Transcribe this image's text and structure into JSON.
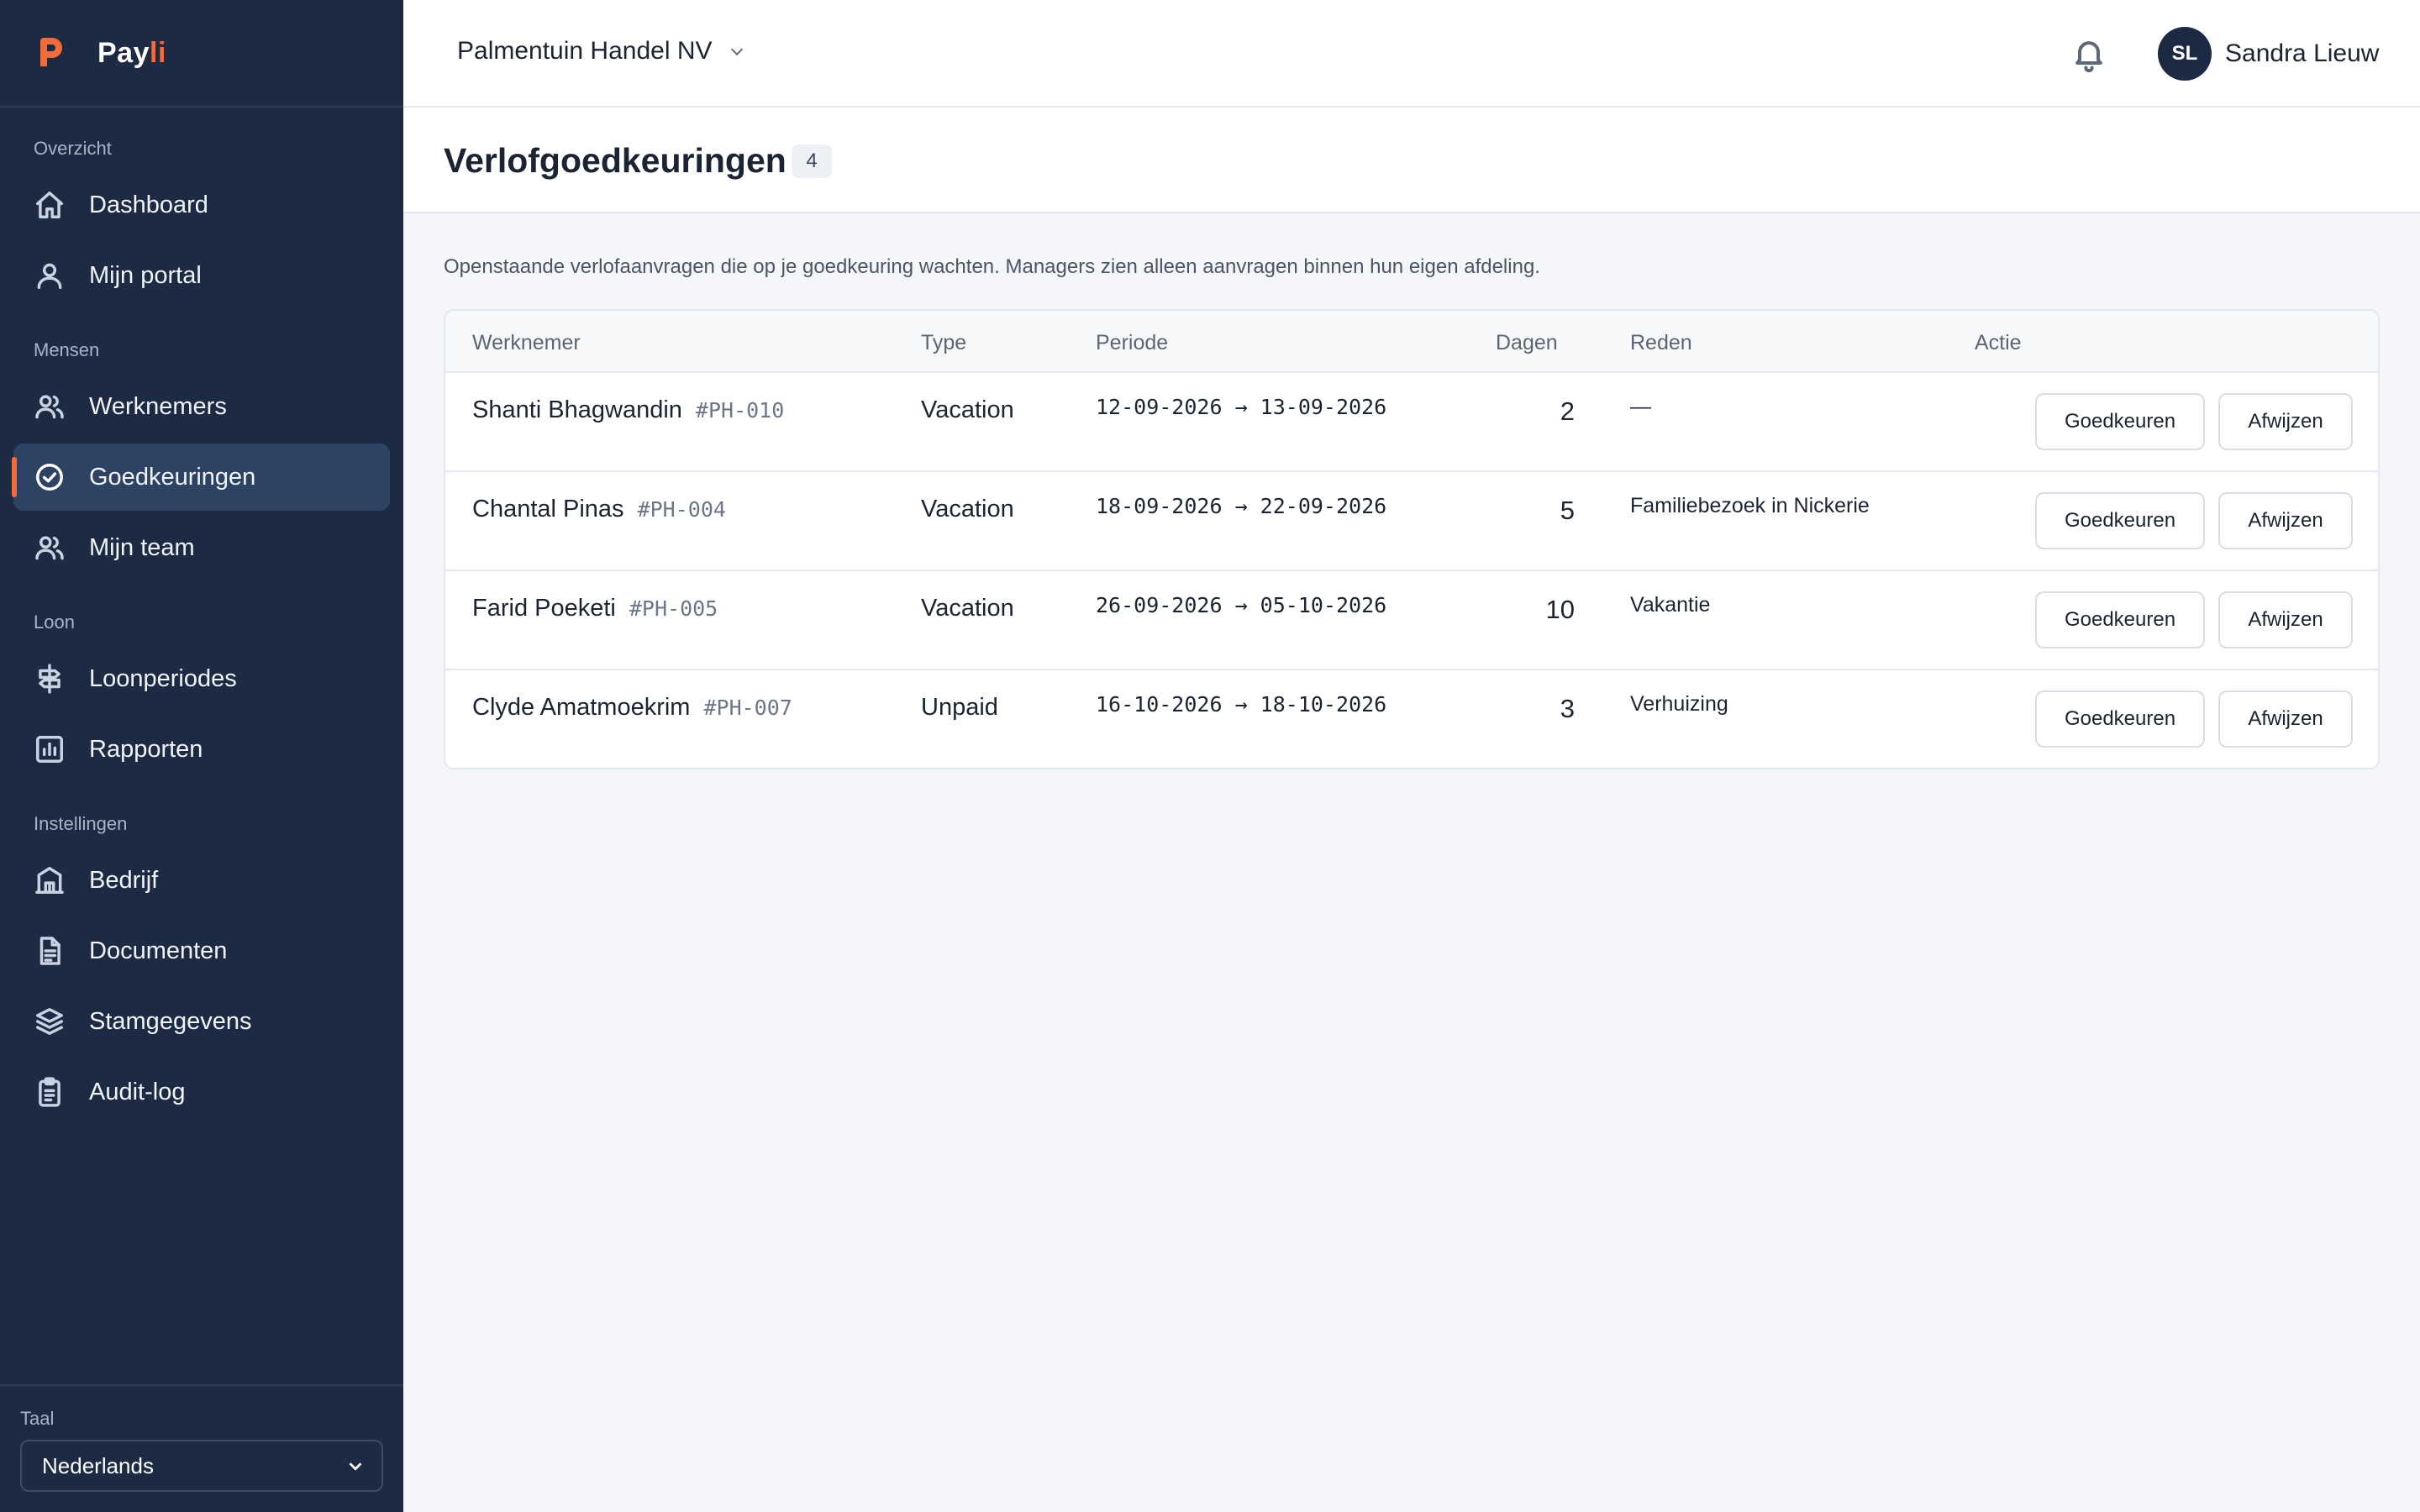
{
  "brand": {
    "name_main": "Pay",
    "name_accent": "li",
    "accent_color": "#f26b3a"
  },
  "sidebar": {
    "sections": [
      {
        "title": "Overzicht",
        "items": [
          {
            "label": "Dashboard",
            "icon": "home-icon"
          },
          {
            "label": "Mijn portal",
            "icon": "user-icon"
          }
        ]
      },
      {
        "title": "Mensen",
        "items": [
          {
            "label": "Werknemers",
            "icon": "users-icon"
          },
          {
            "label": "Goedkeuringen",
            "icon": "check-circle-icon",
            "active": true
          },
          {
            "label": "Mijn team",
            "icon": "team-icon"
          }
        ]
      },
      {
        "title": "Loon",
        "items": [
          {
            "label": "Loonperiodes",
            "icon": "signpost-icon"
          },
          {
            "label": "Rapporten",
            "icon": "bar-chart-icon"
          }
        ]
      },
      {
        "title": "Instellingen",
        "items": [
          {
            "label": "Bedrijf",
            "icon": "building-icon"
          },
          {
            "label": "Documenten",
            "icon": "document-icon"
          },
          {
            "label": "Stamgegevens",
            "icon": "layers-icon"
          },
          {
            "label": "Audit-log",
            "icon": "clipboard-icon"
          }
        ]
      }
    ],
    "footer": {
      "language_label": "Taal",
      "language_value": "Nederlands"
    }
  },
  "topbar": {
    "organization": "Palmentuin Handel NV",
    "user_initials": "SL",
    "user_name": "Sandra Lieuw"
  },
  "page": {
    "title": "Verlofgoedkeuringen",
    "count": "4",
    "intro": "Openstaande verlofaanvragen die op je goedkeuring wachten. Managers zien alleen aanvragen binnen hun eigen afdeling."
  },
  "table": {
    "columns": {
      "employee": "Werknemer",
      "type": "Type",
      "period": "Periode",
      "days": "Dagen",
      "reason": "Reden",
      "action": "Actie"
    },
    "approve_label": "Goedkeuren",
    "reject_label": "Afwijzen",
    "rows": [
      {
        "name": "Shanti Bhagwandin",
        "id": "#PH-010",
        "type": "Vacation",
        "period": "12-09-2026 → 13-09-2026",
        "days": "2",
        "reason": "—"
      },
      {
        "name": "Chantal Pinas",
        "id": "#PH-004",
        "type": "Vacation",
        "period": "18-09-2026 → 22-09-2026",
        "days": "5",
        "reason": "Familiebezoek in Nickerie"
      },
      {
        "name": "Farid Poeketi",
        "id": "#PH-005",
        "type": "Vacation",
        "period": "26-09-2026 → 05-10-2026",
        "days": "10",
        "reason": "Vakantie"
      },
      {
        "name": "Clyde Amatmoekrim",
        "id": "#PH-007",
        "type": "Unpaid",
        "period": "16-10-2026 → 18-10-2026",
        "days": "3",
        "reason": "Verhuizing"
      }
    ]
  }
}
